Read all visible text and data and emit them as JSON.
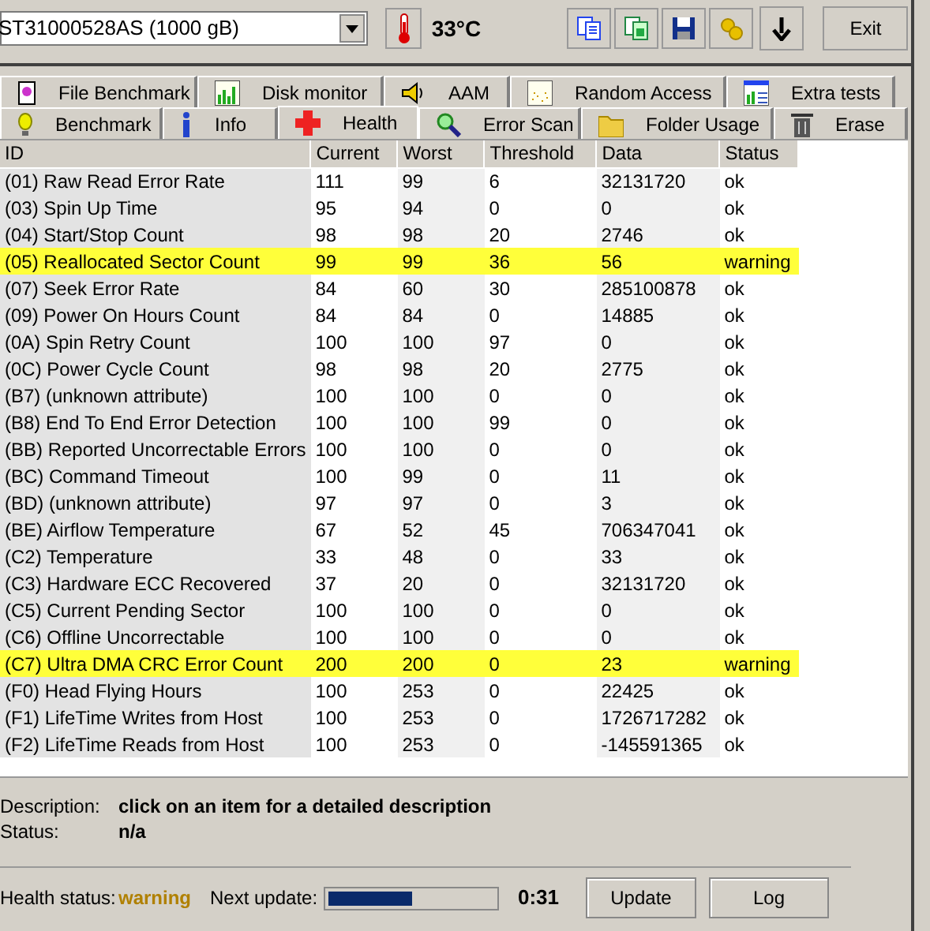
{
  "drive": {
    "value": "ST31000528AS (1000 gB)"
  },
  "temperature": "33°C",
  "exit_button": "Exit",
  "tabs_row_1": [
    {
      "label": "File Benchmark",
      "selected": false
    },
    {
      "label": "Disk monitor",
      "selected": false
    },
    {
      "label": "AAM",
      "selected": false
    },
    {
      "label": "Random Access",
      "selected": false
    },
    {
      "label": "Extra tests",
      "selected": false
    }
  ],
  "tabs_row_2": [
    {
      "label": "Benchmark",
      "selected": false
    },
    {
      "label": "Info",
      "selected": false
    },
    {
      "label": "Health",
      "selected": true
    },
    {
      "label": "Error Scan",
      "selected": false
    },
    {
      "label": "Folder Usage",
      "selected": false
    },
    {
      "label": "Erase",
      "selected": false
    }
  ],
  "table": {
    "columns": [
      "ID",
      "Current",
      "Worst",
      "Threshold",
      "Data",
      "Status"
    ],
    "rows": [
      {
        "cells": [
          "(01) Raw Read Error Rate",
          "111",
          "99",
          "6",
          "32131720",
          "ok"
        ],
        "highlighted": false
      },
      {
        "cells": [
          "(03) Spin Up Time",
          "95",
          "94",
          "0",
          "0",
          "ok"
        ],
        "highlighted": false
      },
      {
        "cells": [
          "(04) Start/Stop Count",
          "98",
          "98",
          "20",
          "2746",
          "ok"
        ],
        "highlighted": false
      },
      {
        "cells": [
          "(05) Reallocated Sector Count",
          "99",
          "99",
          "36",
          "56",
          "warning"
        ],
        "highlighted": true
      },
      {
        "cells": [
          "(07) Seek Error Rate",
          "84",
          "60",
          "30",
          "285100878",
          "ok"
        ],
        "highlighted": false
      },
      {
        "cells": [
          "(09) Power On Hours Count",
          "84",
          "84",
          "0",
          "14885",
          "ok"
        ],
        "highlighted": false
      },
      {
        "cells": [
          "(0A) Spin Retry Count",
          "100",
          "100",
          "97",
          "0",
          "ok"
        ],
        "highlighted": false
      },
      {
        "cells": [
          "(0C) Power Cycle Count",
          "98",
          "98",
          "20",
          "2775",
          "ok"
        ],
        "highlighted": false
      },
      {
        "cells": [
          "(B7) (unknown attribute)",
          "100",
          "100",
          "0",
          "0",
          "ok"
        ],
        "highlighted": false
      },
      {
        "cells": [
          "(B8) End To End Error Detection",
          "100",
          "100",
          "99",
          "0",
          "ok"
        ],
        "highlighted": false
      },
      {
        "cells": [
          "(BB) Reported Uncorrectable Errors",
          "100",
          "100",
          "0",
          "0",
          "ok"
        ],
        "highlighted": false
      },
      {
        "cells": [
          "(BC) Command Timeout",
          "100",
          "99",
          "0",
          "11",
          "ok"
        ],
        "highlighted": false
      },
      {
        "cells": [
          "(BD) (unknown attribute)",
          "97",
          "97",
          "0",
          "3",
          "ok"
        ],
        "highlighted": false
      },
      {
        "cells": [
          "(BE) Airflow Temperature",
          "67",
          "52",
          "45",
          "706347041",
          "ok"
        ],
        "highlighted": false
      },
      {
        "cells": [
          "(C2) Temperature",
          "33",
          "48",
          "0",
          "33",
          "ok"
        ],
        "highlighted": false
      },
      {
        "cells": [
          "(C3) Hardware ECC Recovered",
          "37",
          "20",
          "0",
          "32131720",
          "ok"
        ],
        "highlighted": false
      },
      {
        "cells": [
          "(C5) Current Pending Sector",
          "100",
          "100",
          "0",
          "0",
          "ok"
        ],
        "highlighted": false
      },
      {
        "cells": [
          "(C6) Offline Uncorrectable",
          "100",
          "100",
          "0",
          "0",
          "ok"
        ],
        "highlighted": false
      },
      {
        "cells": [
          "(C7) Ultra DMA CRC Error Count",
          "200",
          "200",
          "0",
          "23",
          "warning"
        ],
        "highlighted": true
      },
      {
        "cells": [
          "(F0) Head Flying Hours",
          "100",
          "253",
          "0",
          "22425",
          "ok"
        ],
        "highlighted": false
      },
      {
        "cells": [
          "(F1) LifeTime Writes from Host",
          "100",
          "253",
          "0",
          "1726717282",
          "ok"
        ],
        "highlighted": false
      },
      {
        "cells": [
          "(F2) LifeTime Reads from Host",
          "100",
          "253",
          "0",
          "-145591365",
          "ok"
        ],
        "highlighted": false
      }
    ]
  },
  "description": {
    "label": "Description:",
    "value": "click on an item for a detailed description"
  },
  "status": {
    "label": "Status:",
    "value": "n/a"
  },
  "health_status": {
    "label": "Health status:",
    "value": "warning"
  },
  "next_update": {
    "label": "Next update:",
    "level": 0.5,
    "time": "0:31"
  },
  "buttons": [
    "Update",
    "Log"
  ]
}
